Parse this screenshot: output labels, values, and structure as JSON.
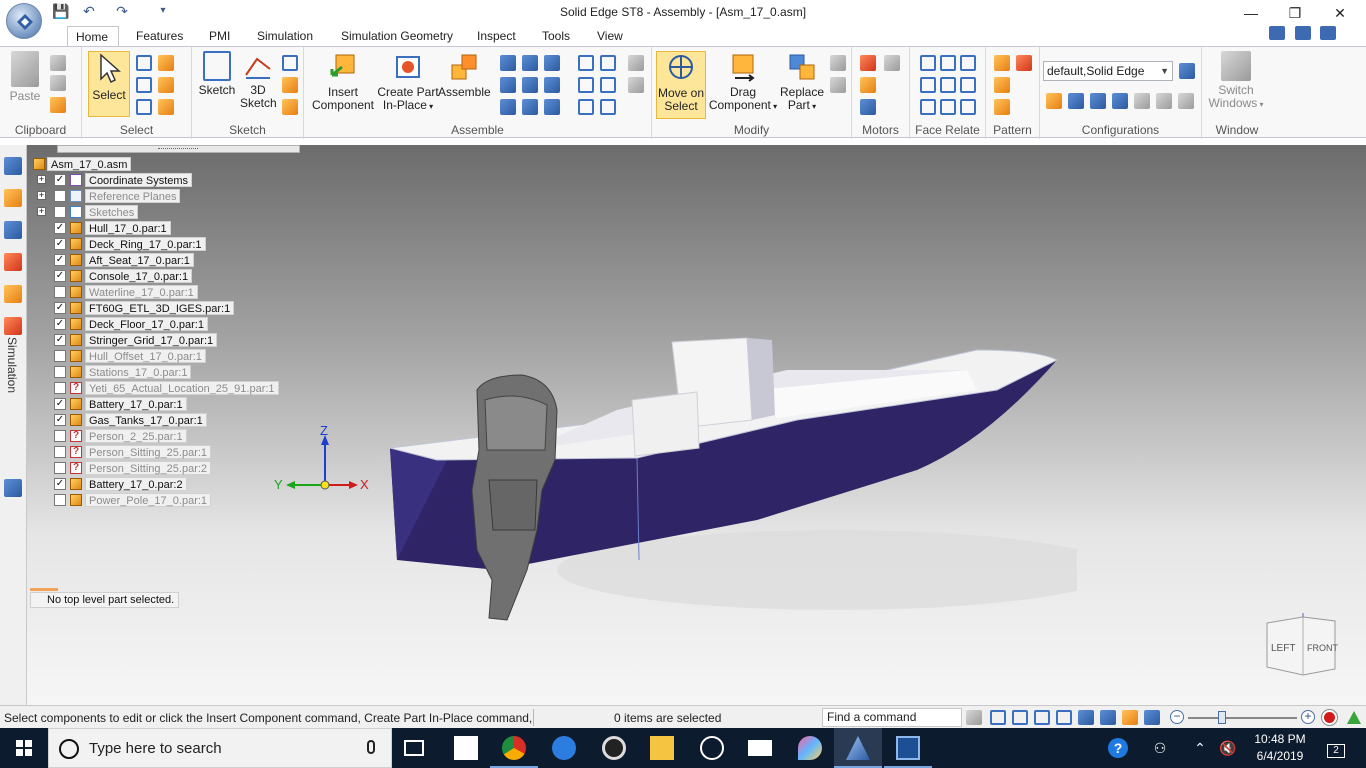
{
  "window": {
    "title": "Solid Edge ST8 - Assembly - [Asm_17_0.asm]",
    "minimize": "—",
    "maximize": "❐",
    "close": "✕"
  },
  "qat": {
    "save": "💾",
    "undo": "↶",
    "redo": "↷",
    "dropdown": "▾"
  },
  "tabs": [
    {
      "label": "Home",
      "active": true
    },
    {
      "label": "Features"
    },
    {
      "label": "PMI"
    },
    {
      "label": "Simulation"
    },
    {
      "label": "Simulation Geometry"
    },
    {
      "label": "Inspect"
    },
    {
      "label": "Tools"
    },
    {
      "label": "View"
    }
  ],
  "ribbon": {
    "groups": {
      "clipboard": "Clipboard",
      "select": "Select",
      "sketch": "Sketch",
      "assemble": "Assemble",
      "modify": "Modify",
      "motors": "Motors",
      "face_relate": "Face Relate",
      "pattern": "Pattern",
      "configurations": "Configurations",
      "window": "Window"
    },
    "buttons": {
      "paste": "Paste",
      "select": "Select",
      "sketch": "Sketch",
      "sketch_3d_line1": "3D",
      "sketch_3d_line2": "Sketch",
      "insert_component_line1": "Insert",
      "insert_component_line2": "Component",
      "create_part_line1": "Create Part",
      "create_part_line2": "In-Place",
      "assemble": "Assemble",
      "move_on_select_line1": "Move on",
      "move_on_select_line2": "Select",
      "drag_component_line1": "Drag",
      "drag_component_line2": "Component",
      "replace_part_line1": "Replace",
      "replace_part_line2": "Part",
      "switch_windows_line1": "Switch",
      "switch_windows_line2": "Windows"
    },
    "configuration_value": "default,Solid Edge"
  },
  "left_strip": {
    "simulation_label": "Simulation"
  },
  "pathfinder": {
    "root": "Asm_17_0.asm",
    "items": [
      {
        "label": "Coordinate Systems",
        "checked": true,
        "expandable": true,
        "icon": "coord",
        "enabled": true
      },
      {
        "label": "Reference Planes",
        "checked": false,
        "expandable": true,
        "icon": "plane",
        "enabled": false
      },
      {
        "label": "Sketches",
        "checked": false,
        "expandable": true,
        "icon": "sketch",
        "enabled": false
      },
      {
        "label": "Hull_17_0.par:1",
        "checked": true,
        "icon": "part",
        "enabled": true
      },
      {
        "label": "Deck_Ring_17_0.par:1",
        "checked": true,
        "icon": "part",
        "enabled": true
      },
      {
        "label": "Aft_Seat_17_0.par:1",
        "checked": true,
        "icon": "part",
        "enabled": true
      },
      {
        "label": "Console_17_0.par:1",
        "checked": true,
        "icon": "part",
        "enabled": true
      },
      {
        "label": "Waterline_17_0.par:1",
        "checked": false,
        "icon": "part",
        "enabled": false
      },
      {
        "label": "FT60G_ETL_3D_IGES.par:1",
        "checked": true,
        "icon": "part",
        "enabled": true
      },
      {
        "label": "Deck_Floor_17_0.par:1",
        "checked": true,
        "icon": "part",
        "enabled": true
      },
      {
        "label": "Stringer_Grid_17_0.par:1",
        "checked": true,
        "icon": "part",
        "enabled": true
      },
      {
        "label": "Hull_Offset_17_0.par:1",
        "checked": false,
        "icon": "part",
        "enabled": false
      },
      {
        "label": "Stations_17_0.par:1",
        "checked": false,
        "icon": "part",
        "enabled": false
      },
      {
        "label": "Yeti_65_Actual_Location_25_91.par:1",
        "checked": false,
        "icon": "missing",
        "enabled": false
      },
      {
        "label": "Battery_17_0.par:1",
        "checked": true,
        "icon": "part",
        "enabled": true
      },
      {
        "label": "Gas_Tanks_17_0.par:1",
        "checked": true,
        "icon": "part",
        "enabled": true
      },
      {
        "label": "Person_2_25.par:1",
        "checked": false,
        "icon": "missing",
        "enabled": false
      },
      {
        "label": "Person_Sitting_25.par:1",
        "checked": false,
        "icon": "missing",
        "enabled": false
      },
      {
        "label": "Person_Sitting_25.par:2",
        "checked": false,
        "icon": "missing",
        "enabled": false
      },
      {
        "label": "Battery_17_0.par:2",
        "checked": true,
        "icon": "part",
        "enabled": true
      },
      {
        "label": "Power_Pole_17_0.par:1",
        "checked": false,
        "icon": "part",
        "enabled": false
      }
    ],
    "status_hint": "No top level part selected."
  },
  "triad": {
    "x": "X",
    "y": "Y",
    "z": "Z"
  },
  "view_cube": {
    "left": "LEFT",
    "front": "FRONT"
  },
  "statusbar": {
    "prompt": "Select components to edit or click the Insert Component command, Create Part In-Place command, or",
    "selection_count": "0 items are selected",
    "find_command": "Find a command",
    "zoom_minus": "−",
    "zoom_plus": "+"
  },
  "taskbar": {
    "search_placeholder": "Type here to search",
    "time": "10:48 PM",
    "date": "6/4/2019",
    "notification_count": "2"
  },
  "colors": {
    "hull": "#2e2466",
    "deck": "#f2f2f2",
    "accent": "#3e6ab3",
    "selected_button": "#fde69a"
  }
}
